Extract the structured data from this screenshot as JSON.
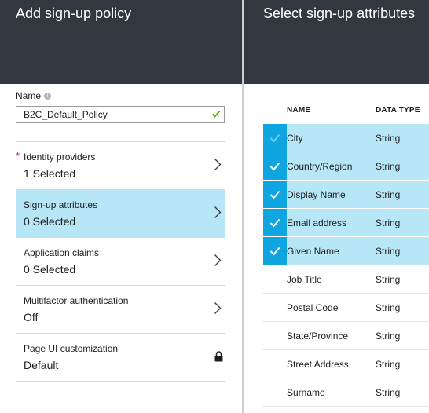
{
  "left_blade": {
    "title": "Add sign-up policy",
    "name_field": {
      "label": "Name",
      "value": "B2C_Default_Policy",
      "info_glyph": "i"
    },
    "required_mark": "*",
    "menu_items": [
      {
        "title": "Identity providers",
        "value": "1 Selected",
        "required": true,
        "active": false,
        "icon": "chevron-right-icon"
      },
      {
        "title": "Sign-up attributes",
        "value": "0 Selected",
        "required": false,
        "active": true,
        "icon": "chevron-right-icon"
      },
      {
        "title": "Application claims",
        "value": "0 Selected",
        "required": false,
        "active": false,
        "icon": "chevron-right-icon"
      },
      {
        "title": "Multifactor authentication",
        "value": "Off",
        "required": false,
        "active": false,
        "icon": "chevron-right-icon"
      },
      {
        "title": "Page UI customization",
        "value": "Default",
        "required": false,
        "active": false,
        "icon": "lock-icon"
      }
    ]
  },
  "right_blade": {
    "title": "Select sign-up attributes",
    "columns": {
      "name": "NAME",
      "type": "DATA TYPE"
    },
    "rows": [
      {
        "name": "City",
        "type": "String",
        "selected": true,
        "check_style": "faint"
      },
      {
        "name": "Country/Region",
        "type": "String",
        "selected": true,
        "check_style": "solid"
      },
      {
        "name": "Display Name",
        "type": "String",
        "selected": true,
        "check_style": "solid"
      },
      {
        "name": "Email address",
        "type": "String",
        "selected": true,
        "check_style": "solid"
      },
      {
        "name": "Given Name",
        "type": "String",
        "selected": true,
        "check_style": "solid"
      },
      {
        "name": "Job Title",
        "type": "String",
        "selected": false
      },
      {
        "name": "Postal Code",
        "type": "String",
        "selected": false
      },
      {
        "name": "State/Province",
        "type": "String",
        "selected": false
      },
      {
        "name": "Street Address",
        "type": "String",
        "selected": false
      },
      {
        "name": "Surname",
        "type": "String",
        "selected": false
      }
    ]
  },
  "colors": {
    "header_bg": "#32383f",
    "selected_bg": "#b7e6f7",
    "check_bg": "#0ea5e0",
    "valid_green": "#5db300",
    "required_magenta": "#b4009e"
  }
}
